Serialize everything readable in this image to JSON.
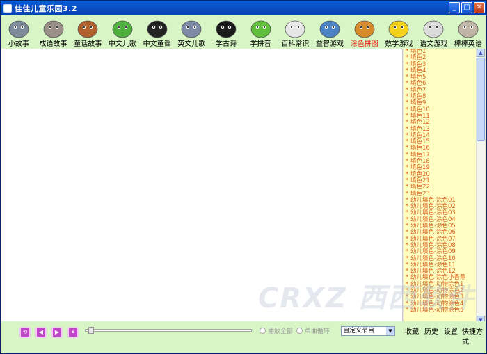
{
  "window": {
    "title": "佳佳儿童乐园3.2"
  },
  "toolbar": {
    "items": [
      {
        "label": "小故事",
        "icon": "elephant-icon",
        "color": "#7d8a9a"
      },
      {
        "label": "成语故事",
        "icon": "hippo-icon",
        "color": "#9a8f88"
      },
      {
        "label": "童话故事",
        "icon": "fox-icon",
        "color": "#b0602c"
      },
      {
        "label": "中文儿歌",
        "icon": "leaf-icon",
        "color": "#4caf3c"
      },
      {
        "label": "中文童谣",
        "icon": "panda-icon",
        "color": "#222222"
      },
      {
        "label": "英文儿歌",
        "icon": "beetle-icon",
        "color": "#7d8aa6"
      },
      {
        "label": "学古诗",
        "icon": "toucan-icon",
        "color": "#1a1a1a"
      },
      {
        "label": "学拼音",
        "icon": "frog-icon",
        "color": "#5fbf3a"
      },
      {
        "label": "百科常识",
        "icon": "rabbit-icon",
        "color": "#e6e6e6"
      },
      {
        "label": "益智游戏",
        "icon": "dolphin-icon",
        "color": "#4a82c4"
      },
      {
        "label": "涂色拼图",
        "icon": "lion-icon",
        "color": "#d68a2a",
        "active": true
      },
      {
        "label": "数学游戏",
        "icon": "duck-icon",
        "color": "#f4d21a"
      },
      {
        "label": "语文游戏",
        "icon": "cat-icon",
        "color": "#dcdcdc"
      },
      {
        "label": "棒棒英语",
        "icon": "dog-icon",
        "color": "#bfb4a6"
      }
    ]
  },
  "list": {
    "items": [
      "* 填色1",
      "* 填色2",
      "* 填色3",
      "* 填色4",
      "* 填色5",
      "* 填色6",
      "* 填色7",
      "* 填色8",
      "* 填色9",
      "* 填色10",
      "* 填色11",
      "* 填色12",
      "* 填色13",
      "* 填色14",
      "* 填色15",
      "* 填色16",
      "* 填色17",
      "* 填色18",
      "* 填色19",
      "* 填色20",
      "* 填色21",
      "* 填色22",
      "* 填色23",
      "* 幼儿填色-涂色01",
      "* 幼儿填色-涂色02",
      "* 幼儿填色-涂色03",
      "* 幼儿填色-涂色04",
      "* 幼儿填色-涂色05",
      "* 幼儿填色-涂色06",
      "* 幼儿填色-涂色07",
      "* 幼儿填色-涂色08",
      "* 幼儿填色-涂色09",
      "* 幼儿填色-涂色10",
      "* 幼儿填色-涂色11",
      "* 幼儿填色-涂色12",
      "* 幼儿填色-涂色小香蕉",
      "* 幼儿填色-动物涂色1",
      "* 幼儿填色-动物涂色2",
      "* 幼儿填色-动物涂色3",
      "* 幼儿填色-动物涂色4",
      "* 幼儿填色-动物涂色5"
    ]
  },
  "player": {
    "buttons": [
      {
        "name": "restart-button",
        "glyph": "⟲"
      },
      {
        "name": "prev-button",
        "glyph": "◀"
      },
      {
        "name": "play-button",
        "glyph": "▶"
      },
      {
        "name": "pause-button",
        "glyph": "⏸"
      }
    ],
    "play_all_label": "播放全部",
    "loop_label": "单曲循环",
    "program_select": "自定义节目"
  },
  "links": {
    "favorites": "收藏",
    "history": "历史",
    "settings": "设置",
    "shortcuts": "快捷方式"
  },
  "watermark": "CRXZ 西西软件"
}
